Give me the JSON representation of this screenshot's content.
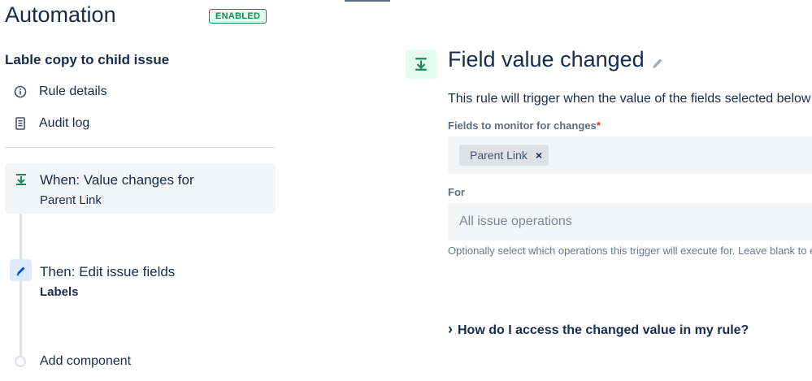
{
  "header": {
    "title": "Automation",
    "status": "ENABLED"
  },
  "rule": {
    "name": "Lable copy to child issue"
  },
  "nav": {
    "items": [
      {
        "label": "Rule details",
        "icon": "info-icon"
      },
      {
        "label": "Audit log",
        "icon": "document-icon"
      }
    ]
  },
  "steps": {
    "when": {
      "title": "When: Value changes for",
      "subtitle": "Parent Link",
      "icon": "trigger-download-icon"
    },
    "then": {
      "title": "Then: Edit issue fields",
      "subtitle": "Labels",
      "icon": "pencil-icon"
    },
    "add_label": "Add component"
  },
  "trigger": {
    "title": "Field value changed",
    "description": "This rule will trigger when the value of the fields selected below are changed.",
    "fields_label": "Fields to monitor for changes",
    "required_mark": "*",
    "selected_field": "Parent Link",
    "remove_glyph": "×",
    "for_label": "For",
    "for_placeholder": "All issue operations",
    "help_text": "Optionally select which operations this trigger will execute for. Leave blank to execute for all operations.",
    "faq": "How do I access the changed value in my rule?",
    "faq_chevron": "›"
  },
  "colors": {
    "accent_green": "#1f845a",
    "accent_blue": "#0052cc",
    "text": "#172b4d"
  }
}
